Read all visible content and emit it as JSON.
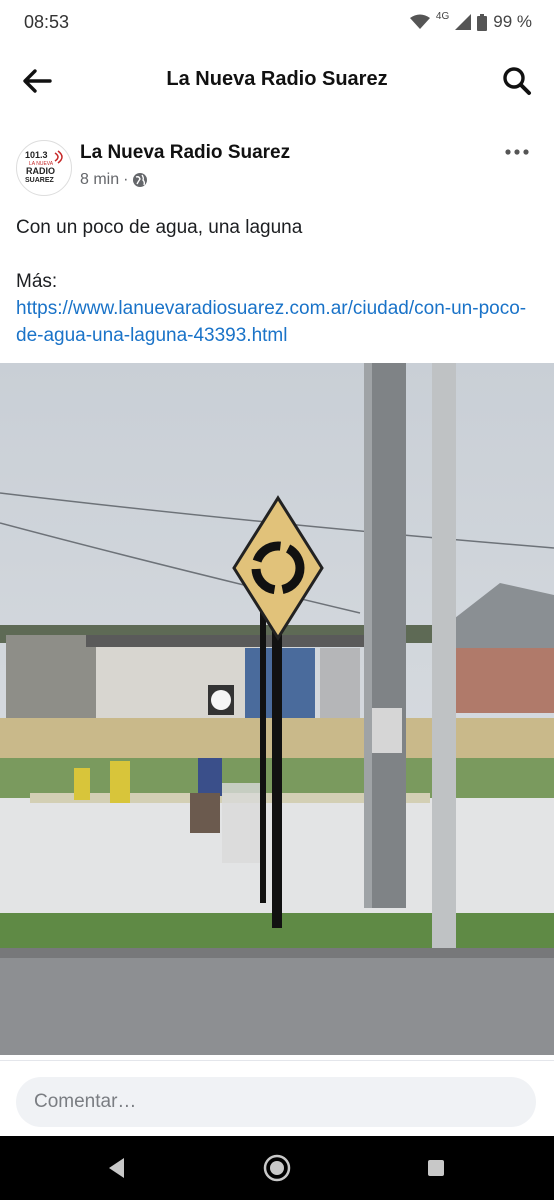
{
  "status_bar": {
    "time": "08:53",
    "network": "4G",
    "battery": "99 %"
  },
  "header": {
    "title": "La Nueva Radio Suarez",
    "back_icon": "arrow-left-icon",
    "search_icon": "search-icon"
  },
  "post": {
    "page_name": "La Nueva Radio Suarez",
    "avatar_text": {
      "line1": "101.3",
      "line2": "LA NUEVA",
      "line3": "RADIO",
      "line4": "SUAREZ"
    },
    "time": "8 min",
    "separator": "·",
    "audience_icon": "globe-icon",
    "text": "Con un poco de agua, una laguna",
    "more_label": "Más:",
    "link": "https://www.lanuevaradiosuarez.com.ar/ciudad/con-un-poco-de-agua-una-laguna-43393.html",
    "photo_icon": "roundabout-sign-photo"
  },
  "comment": {
    "placeholder": "Comentar…"
  },
  "nav": {
    "back_icon": "triangle-back-icon",
    "home_icon": "circle-home-icon",
    "recents_icon": "square-recents-icon"
  },
  "colors": {
    "link": "#1a73c8",
    "text": "#1c1e21",
    "meta": "#65676b",
    "nav_bg": "#000000"
  }
}
